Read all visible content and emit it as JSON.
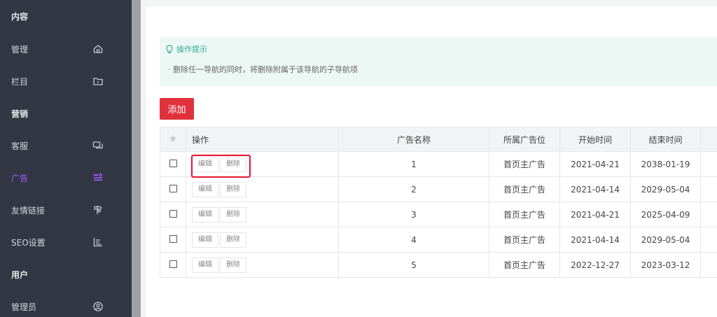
{
  "sidebar": {
    "items": [
      {
        "label": "内容",
        "icon": "",
        "group": true
      },
      {
        "label": "管理",
        "icon": "home-icon",
        "group": false
      },
      {
        "label": "栏目",
        "icon": "folder-icon",
        "group": false
      },
      {
        "label": "营销",
        "icon": "",
        "group": true
      },
      {
        "label": "客服",
        "icon": "chat-icon",
        "group": false
      },
      {
        "label": "广告",
        "icon": "ad-icon",
        "group": false,
        "active": true
      },
      {
        "label": "友情链接",
        "icon": "signpost-icon",
        "group": false
      },
      {
        "label": "SEO设置",
        "icon": "chart-icon",
        "group": false
      },
      {
        "label": "用户",
        "icon": "",
        "group": true
      },
      {
        "label": "管理员",
        "icon": "user-circle-icon",
        "group": false
      }
    ]
  },
  "tip": {
    "title": "操作提示",
    "text": "· 删除任一导航的同时，将删除附属于该导航的子导航项"
  },
  "toolbar": {
    "add_label": "添加"
  },
  "table": {
    "headers": [
      "操作",
      "广告名称",
      "所属广告位",
      "开始时间",
      "结束时间"
    ],
    "edit_label": "编辑",
    "delete_label": "删除",
    "rows": [
      {
        "name": "1",
        "position": "首页主广告",
        "start": "2021-04-21",
        "end": "2038-01-19"
      },
      {
        "name": "2",
        "position": "首页主广告",
        "start": "2021-04-14",
        "end": "2029-05-04"
      },
      {
        "name": "3",
        "position": "首页主广告",
        "start": "2021-04-21",
        "end": "2025-04-09"
      },
      {
        "name": "4",
        "position": "首页主广告",
        "start": "2021-04-14",
        "end": "2029-05-04"
      },
      {
        "name": "5",
        "position": "首页主广告",
        "start": "2022-12-27",
        "end": "2023-03-12"
      }
    ]
  },
  "colors": {
    "accent": "#e0323c",
    "active_menu": "#a45cff",
    "sidebar_bg": "#333744",
    "tip_bg": "#edf8f5",
    "tip_title": "#2bae8f",
    "highlight": "#e6162d"
  }
}
